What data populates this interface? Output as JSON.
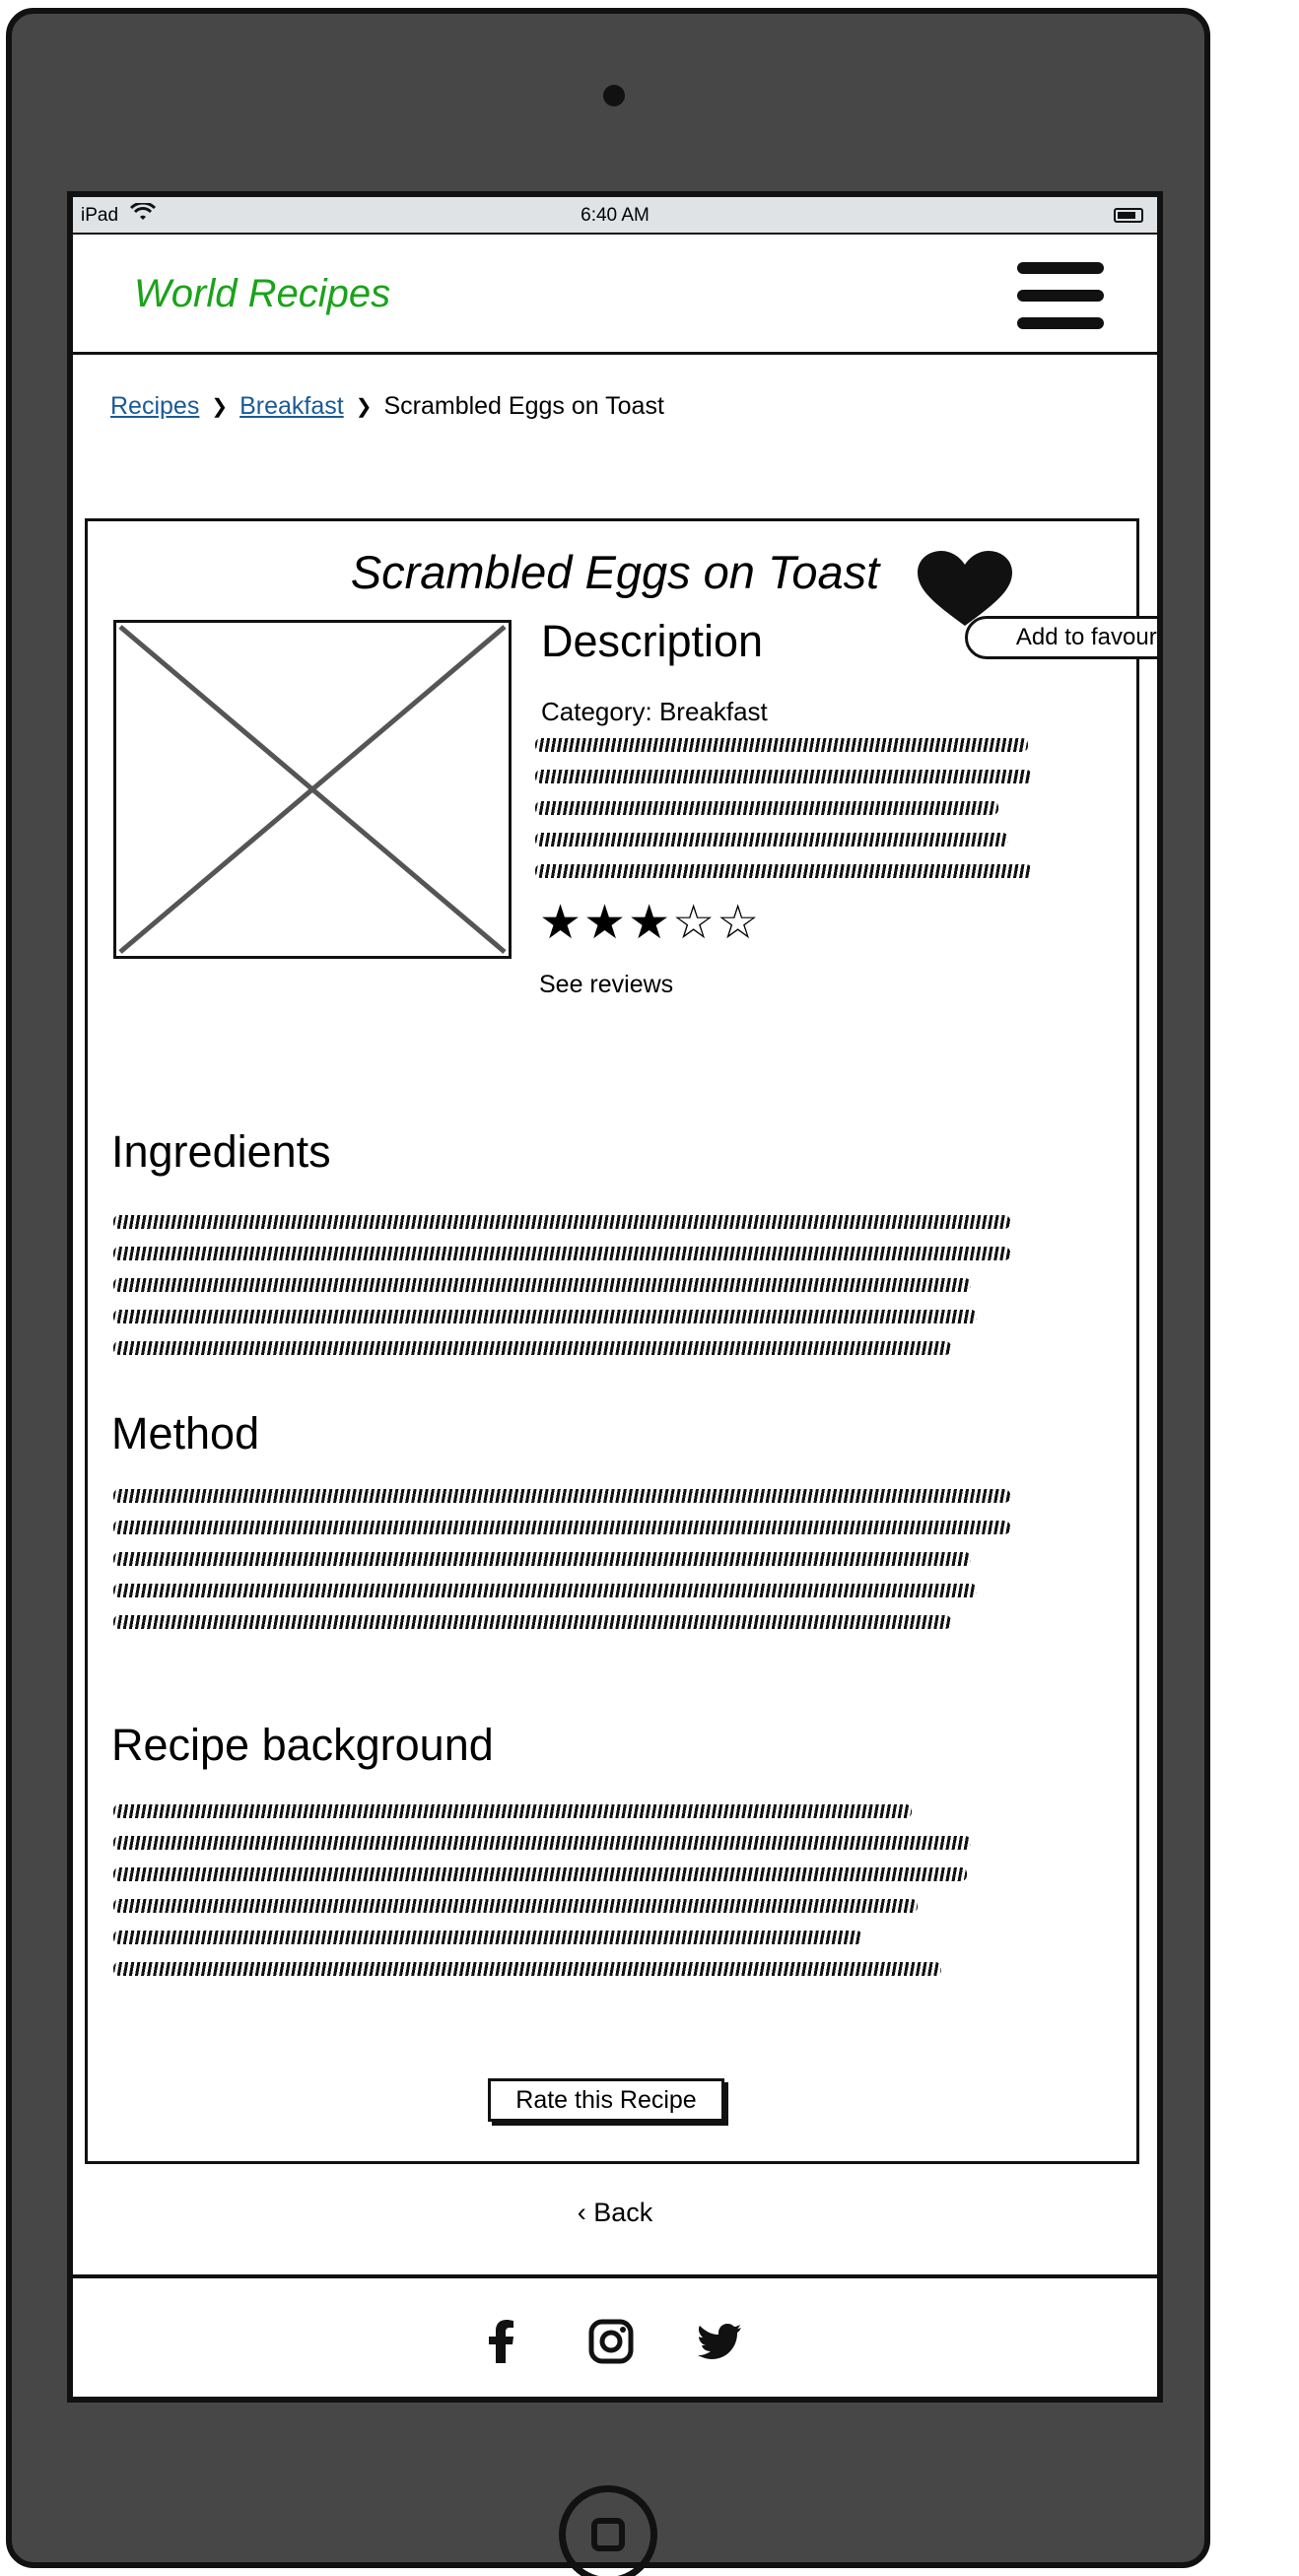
{
  "status_bar": {
    "carrier": "iPad",
    "time": "6:40 AM"
  },
  "header": {
    "brand": "World Recipes",
    "menu_icon": "hamburger-menu-icon"
  },
  "breadcrumb": {
    "items": [
      "Recipes",
      "Breakfast"
    ],
    "current": "Scrambled Eggs on Toast"
  },
  "recipe": {
    "title": "Scrambled Eggs on Toast",
    "favourite_tooltip": "Add to favourite recipes",
    "description_heading": "Description",
    "category": "Category: Breakfast",
    "rating": {
      "value": 3,
      "max": 5
    },
    "see_reviews": "See reviews"
  },
  "sections": {
    "ingredients": "Ingredients",
    "method": "Method",
    "background": "Recipe background"
  },
  "actions": {
    "rate": "Rate this Recipe",
    "back": "Back"
  },
  "footer": {
    "icons": [
      "facebook-icon",
      "instagram-icon",
      "twitter-icon"
    ]
  }
}
